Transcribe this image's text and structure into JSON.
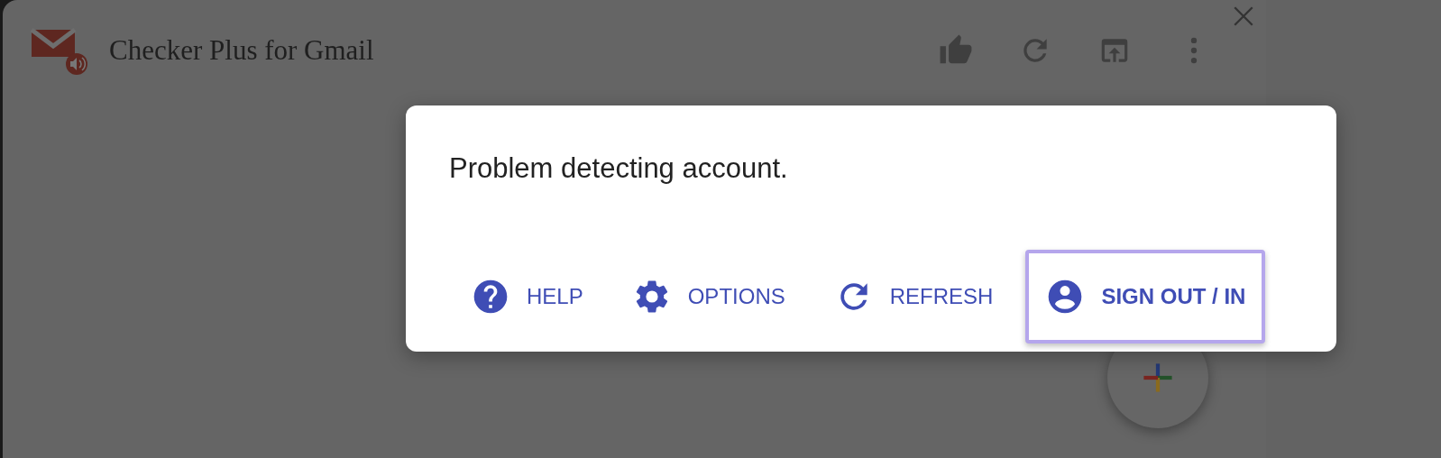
{
  "window": {
    "title": "Checker Plus for Gmail"
  },
  "dialog": {
    "message": "Problem detecting account.",
    "buttons": [
      {
        "kind": "help",
        "label": "HELP",
        "focused": false
      },
      {
        "kind": "options",
        "label": "OPTIONS",
        "focused": false
      },
      {
        "kind": "refresh",
        "label": "REFRESH",
        "focused": false
      },
      {
        "kind": "account",
        "label": "SIGN OUT / IN",
        "focused": true
      }
    ]
  }
}
